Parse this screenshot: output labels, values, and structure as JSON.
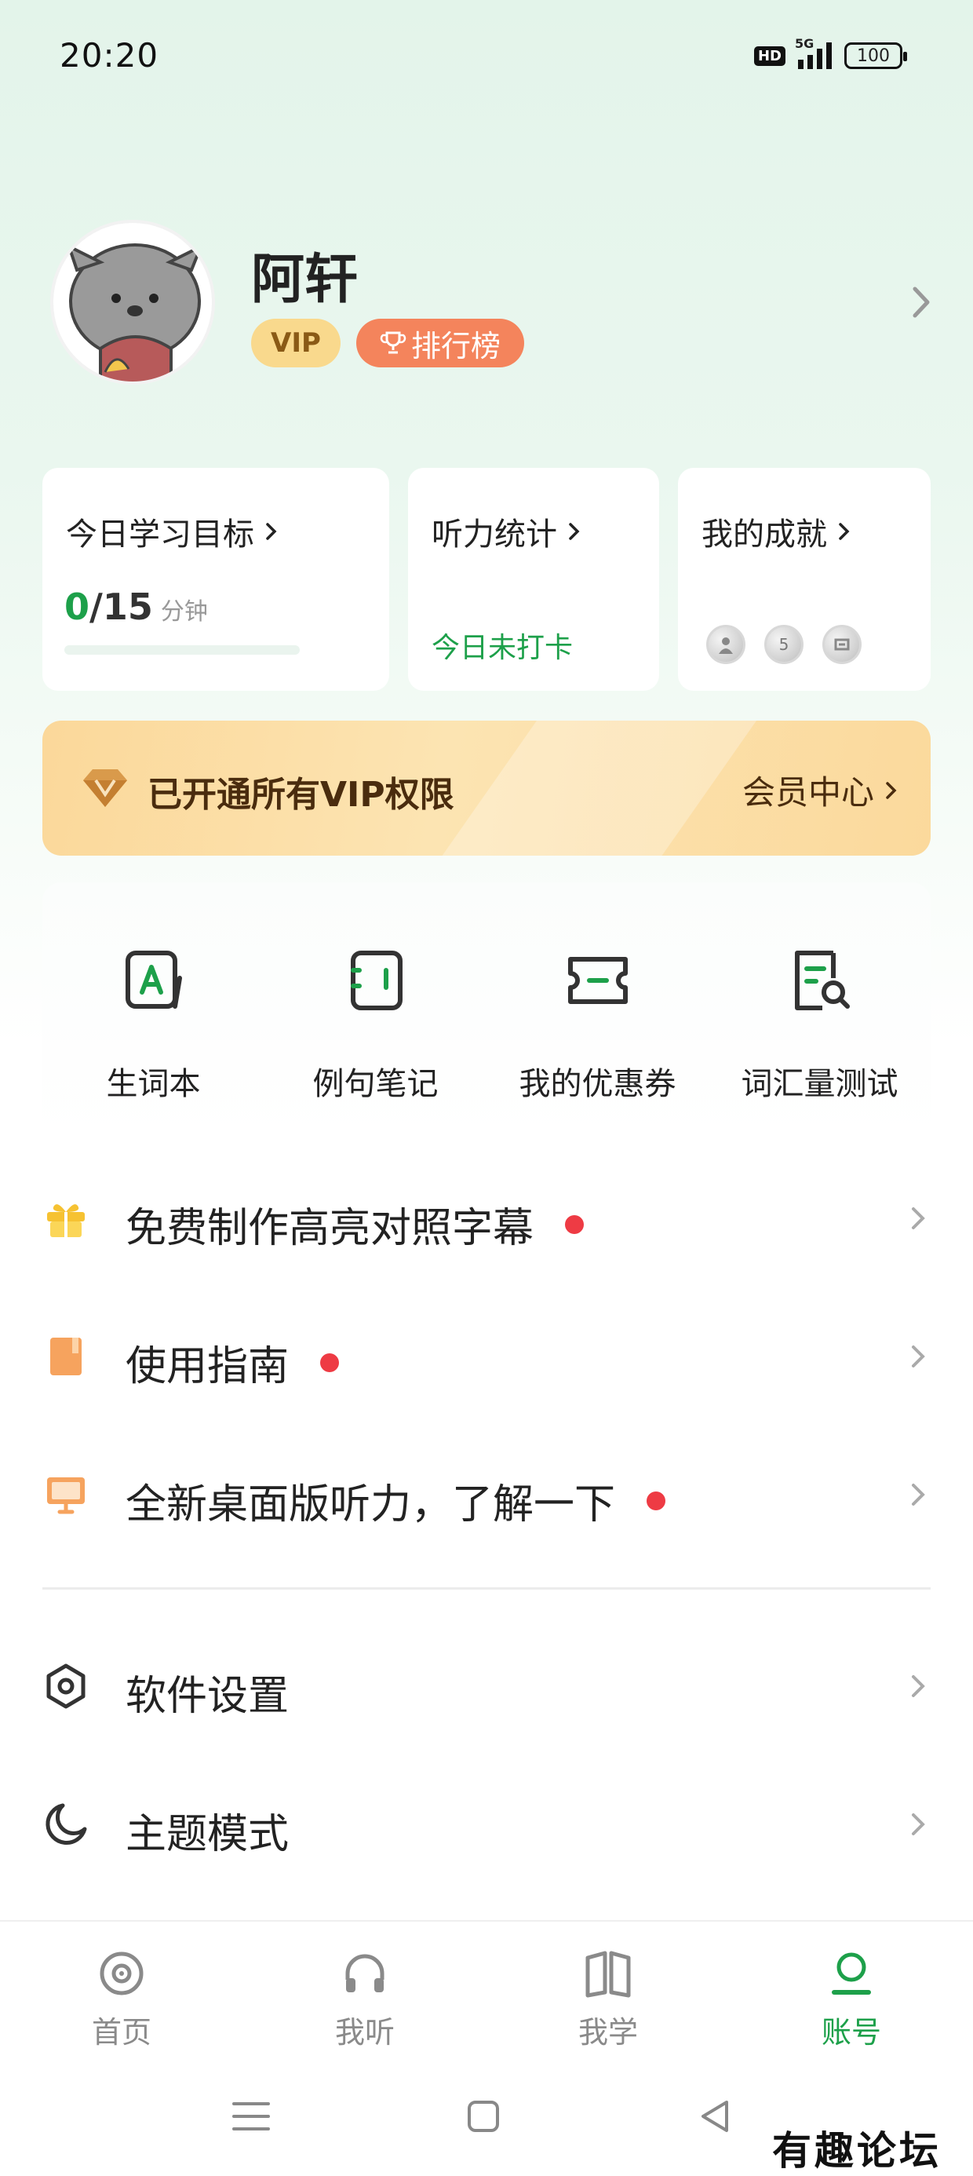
{
  "status_bar": {
    "time": "20:20",
    "hd": "HD",
    "network": "5G",
    "battery": "100"
  },
  "profile": {
    "name": "阿轩",
    "vip_badge": "VIP",
    "rank_badge": "排行榜"
  },
  "stats": {
    "goal": {
      "title": "今日学习目标",
      "current": "0",
      "total": "/15",
      "unit": "分钟",
      "progress_fraction": 0
    },
    "listening": {
      "title": "听力统计",
      "status": "今日未打卡"
    },
    "achievements": {
      "title": "我的成就",
      "medal_label": "5"
    }
  },
  "vip_banner": {
    "text": "已开通所有VIP权限",
    "link": "会员中心"
  },
  "tools": [
    {
      "label": "生词本",
      "icon": "vocab-book-icon"
    },
    {
      "label": "例句笔记",
      "icon": "sentence-note-icon"
    },
    {
      "label": "我的优惠券",
      "icon": "coupon-icon"
    },
    {
      "label": "词汇量测试",
      "icon": "vocab-test-icon"
    }
  ],
  "menu": [
    {
      "label": "免费制作高亮对照字幕",
      "icon": "gift-icon",
      "has_dot": true
    },
    {
      "label": "使用指南",
      "icon": "book-icon",
      "has_dot": true
    },
    {
      "label": "全新桌面版听力，了解一下",
      "icon": "monitor-icon",
      "has_dot": true
    },
    {
      "label": "软件设置",
      "icon": "settings-icon",
      "has_dot": false
    },
    {
      "label": "主题模式",
      "icon": "moon-icon",
      "has_dot": false
    }
  ],
  "bottom_nav": [
    {
      "label": "首页",
      "icon": "home-disc-icon",
      "active": false
    },
    {
      "label": "我听",
      "icon": "headphones-icon",
      "active": false
    },
    {
      "label": "我学",
      "icon": "open-book-icon",
      "active": false
    },
    {
      "label": "账号",
      "icon": "account-icon",
      "active": true
    }
  ],
  "watermark": "有趣论坛",
  "colors": {
    "accent": "#1da04a",
    "rank": "#f4845c",
    "vip_gold": "#fbd89a",
    "dot": "#ee3b44"
  }
}
